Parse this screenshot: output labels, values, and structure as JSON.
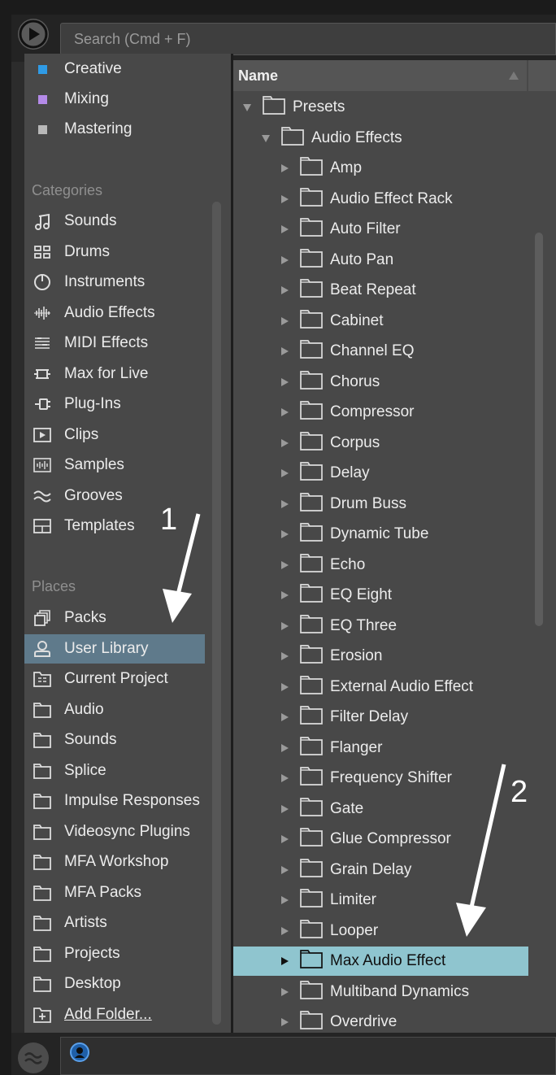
{
  "header": {
    "search_placeholder": "Search (Cmd + F)"
  },
  "sidebar": {
    "collections": [
      {
        "label": "Creative",
        "color": "#2f9be6"
      },
      {
        "label": "Mixing",
        "color": "#b48ae8"
      },
      {
        "label": "Mastering",
        "color": "#b8b8b8"
      }
    ],
    "categories_heading": "Categories",
    "categories": [
      {
        "label": "Sounds",
        "icon": "music-note-icon"
      },
      {
        "label": "Drums",
        "icon": "drum-pads-icon"
      },
      {
        "label": "Instruments",
        "icon": "power-knob-icon"
      },
      {
        "label": "Audio Effects",
        "icon": "waveform-icon"
      },
      {
        "label": "MIDI Effects",
        "icon": "midi-lines-icon"
      },
      {
        "label": "Max for Live",
        "icon": "max-for-live-icon"
      },
      {
        "label": "Plug-Ins",
        "icon": "plug-icon"
      },
      {
        "label": "Clips",
        "icon": "clip-play-icon"
      },
      {
        "label": "Samples",
        "icon": "sample-wave-icon"
      },
      {
        "label": "Grooves",
        "icon": "groove-wave-icon"
      },
      {
        "label": "Templates",
        "icon": "template-icon"
      }
    ],
    "places_heading": "Places",
    "places": [
      {
        "label": "Packs",
        "icon": "packs-icon"
      },
      {
        "label": "User Library",
        "icon": "user-icon",
        "selected": true
      },
      {
        "label": "Current Project",
        "icon": "project-folder-icon"
      },
      {
        "label": "Audio",
        "icon": "folder-icon"
      },
      {
        "label": "Sounds",
        "icon": "folder-icon"
      },
      {
        "label": "Splice",
        "icon": "folder-icon"
      },
      {
        "label": "Impulse Responses",
        "icon": "folder-icon"
      },
      {
        "label": "Videosync Plugins",
        "icon": "folder-icon"
      },
      {
        "label": "MFA Workshop",
        "icon": "folder-icon"
      },
      {
        "label": "MFA Packs",
        "icon": "folder-icon"
      },
      {
        "label": "Artists",
        "icon": "folder-icon"
      },
      {
        "label": "Projects",
        "icon": "folder-icon"
      },
      {
        "label": "Desktop",
        "icon": "folder-icon"
      },
      {
        "label": "Add Folder...",
        "icon": "add-folder-icon",
        "link": true
      }
    ]
  },
  "browser": {
    "column_name": "Name",
    "tree": [
      {
        "label": "Presets",
        "level": 0,
        "expanded": true
      },
      {
        "label": "Audio Effects",
        "level": 1,
        "expanded": true
      },
      {
        "label": "Amp",
        "level": 2
      },
      {
        "label": "Audio Effect Rack",
        "level": 2
      },
      {
        "label": "Auto Filter",
        "level": 2
      },
      {
        "label": "Auto Pan",
        "level": 2
      },
      {
        "label": "Beat Repeat",
        "level": 2
      },
      {
        "label": "Cabinet",
        "level": 2
      },
      {
        "label": "Channel EQ",
        "level": 2
      },
      {
        "label": "Chorus",
        "level": 2
      },
      {
        "label": "Compressor",
        "level": 2
      },
      {
        "label": "Corpus",
        "level": 2
      },
      {
        "label": "Delay",
        "level": 2
      },
      {
        "label": "Drum Buss",
        "level": 2
      },
      {
        "label": "Dynamic Tube",
        "level": 2
      },
      {
        "label": "Echo",
        "level": 2
      },
      {
        "label": "EQ Eight",
        "level": 2
      },
      {
        "label": "EQ Three",
        "level": 2
      },
      {
        "label": "Erosion",
        "level": 2
      },
      {
        "label": "External Audio Effect",
        "level": 2
      },
      {
        "label": "Filter Delay",
        "level": 2
      },
      {
        "label": "Flanger",
        "level": 2
      },
      {
        "label": "Frequency Shifter",
        "level": 2
      },
      {
        "label": "Gate",
        "level": 2
      },
      {
        "label": "Glue Compressor",
        "level": 2
      },
      {
        "label": "Grain Delay",
        "level": 2
      },
      {
        "label": "Limiter",
        "level": 2
      },
      {
        "label": "Looper",
        "level": 2
      },
      {
        "label": "Max Audio Effect",
        "level": 2,
        "selected": true
      },
      {
        "label": "Multiband Dynamics",
        "level": 2
      },
      {
        "label": "Overdrive",
        "level": 2
      }
    ]
  },
  "annotations": {
    "step1": "1",
    "step2": "2"
  },
  "colors": {
    "selection_blue": "#5f7a8b",
    "selection_cyan": "#8fc5cf",
    "panel": "#484848"
  }
}
